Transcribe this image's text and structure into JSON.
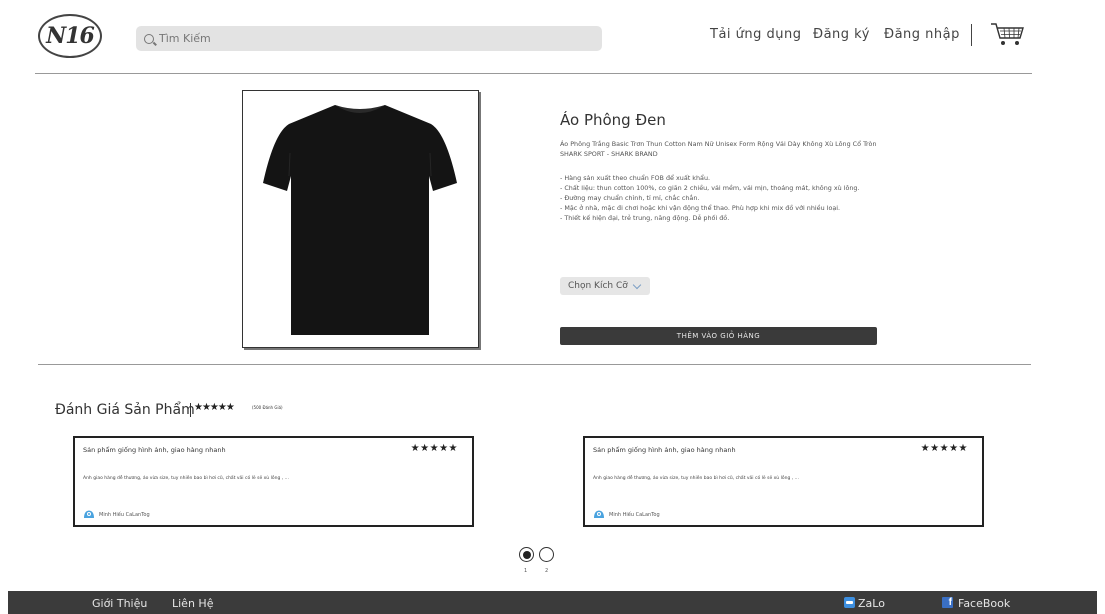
{
  "header": {
    "logo_text": "N16",
    "search_placeholder": "Tìm Kiếm",
    "nav": {
      "download_app": "Tải ứng dụng",
      "register": "Đăng ký",
      "login": "Đăng nhập"
    },
    "cart_icon": "cart-icon"
  },
  "product": {
    "image_icon": "black-tshirt",
    "title": "Áo Phông Đen",
    "subtitle": "Áo Phông Trắng Basic Trơn Thun Cotton Nam Nữ Unisex Form Rộng Vải Dày Không Xù Lông Cổ Tròn SHARK SPORT - SHARK BRAND",
    "description": [
      "- Hàng sản xuất theo chuẩn FOB để xuất khẩu.",
      "- Chất liệu: thun cotton 100%, co giãn 2 chiều, vải mềm, vải mịn, thoáng mát, không xù lông.",
      "- Đường may chuẩn chỉnh, tỉ mỉ, chắc chắn.",
      "- Mặc ở nhà, mặc đi chơi hoặc khi vận động thể thao. Phù hợp khi mix đồ với nhiều loại.",
      "- Thiết kế hiện đại, trẻ trung, năng động. Dễ phối đồ."
    ],
    "size_select_label": "Chọn Kích Cỡ",
    "add_to_cart_label": "THÊM VÀO GIỎ HÀNG"
  },
  "reviews": {
    "title": "Đánh Giá Sản Phẩm",
    "stars": "★★★★★",
    "count_text": "(500 Đánh Giá)",
    "cards": [
      {
        "title": "Sản phẩm giống hình ảnh, giao hàng nhanh",
        "stars": "★★★★★",
        "body": "Anh giao hàng dễ thương, áo vừa size, tuy nhiên bao bì hơi cũ, chất vải có lẽ sẽ xù lông , ...",
        "user": "Minh Hiếu CaLanTog"
      },
      {
        "title": "Sản phẩm giống hình ảnh, giao hàng nhanh",
        "stars": "★★★★★",
        "body": "Anh giao hàng dễ thương, áo vừa size, tuy nhiên bao bì hơi cũ, chất vải có lẽ sẽ xù lông , ...",
        "user": "Minh Hiếu CaLanTog"
      }
    ],
    "pagination": {
      "pages": [
        "1",
        "2"
      ],
      "current": "1"
    }
  },
  "footer": {
    "about": "Giới Thiệu",
    "contact": "Liên Hệ",
    "zalo": "ZaLo",
    "facebook": "FaceBook"
  },
  "colors": {
    "footer_bg": "#3b3b3b",
    "button_bg": "#3a3a3a",
    "search_bg": "#e3e3e3",
    "zalo": "#3d8fe0",
    "facebook": "#3a6fc4"
  }
}
